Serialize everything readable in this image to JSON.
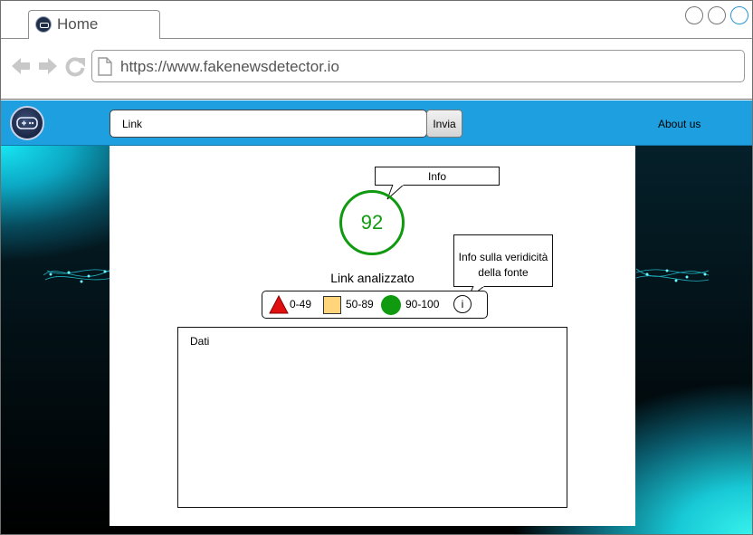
{
  "browser": {
    "tab": {
      "label": "Home",
      "favicon": "site-logo-icon"
    },
    "url": "https://www.fakenewsdetector.io",
    "window_buttons": [
      "minimize",
      "maximize",
      "close"
    ],
    "nav_icons": [
      "back-arrow-icon",
      "forward-arrow-icon",
      "reload-icon"
    ]
  },
  "navbar": {
    "search": {
      "value": "Link"
    },
    "send_label": "Invia",
    "about_label": "About us",
    "color": "#1ea0e0"
  },
  "result": {
    "score": "92",
    "score_color": "#109a10",
    "info_callout": "Info",
    "source_callout_line1": "Info sulla veridicità",
    "source_callout_line2": "della fonte",
    "analyzed_label": "Link analizzato"
  },
  "legend": {
    "items": [
      {
        "range": "0-49",
        "shape": "triangle",
        "color": "#e01010"
      },
      {
        "range": "50-89",
        "shape": "square",
        "color": "#ffd47a"
      },
      {
        "range": "90-100",
        "shape": "circle",
        "color": "#109a10"
      }
    ],
    "info_icon_label": "i"
  },
  "data_panel": {
    "title": "Dati"
  }
}
